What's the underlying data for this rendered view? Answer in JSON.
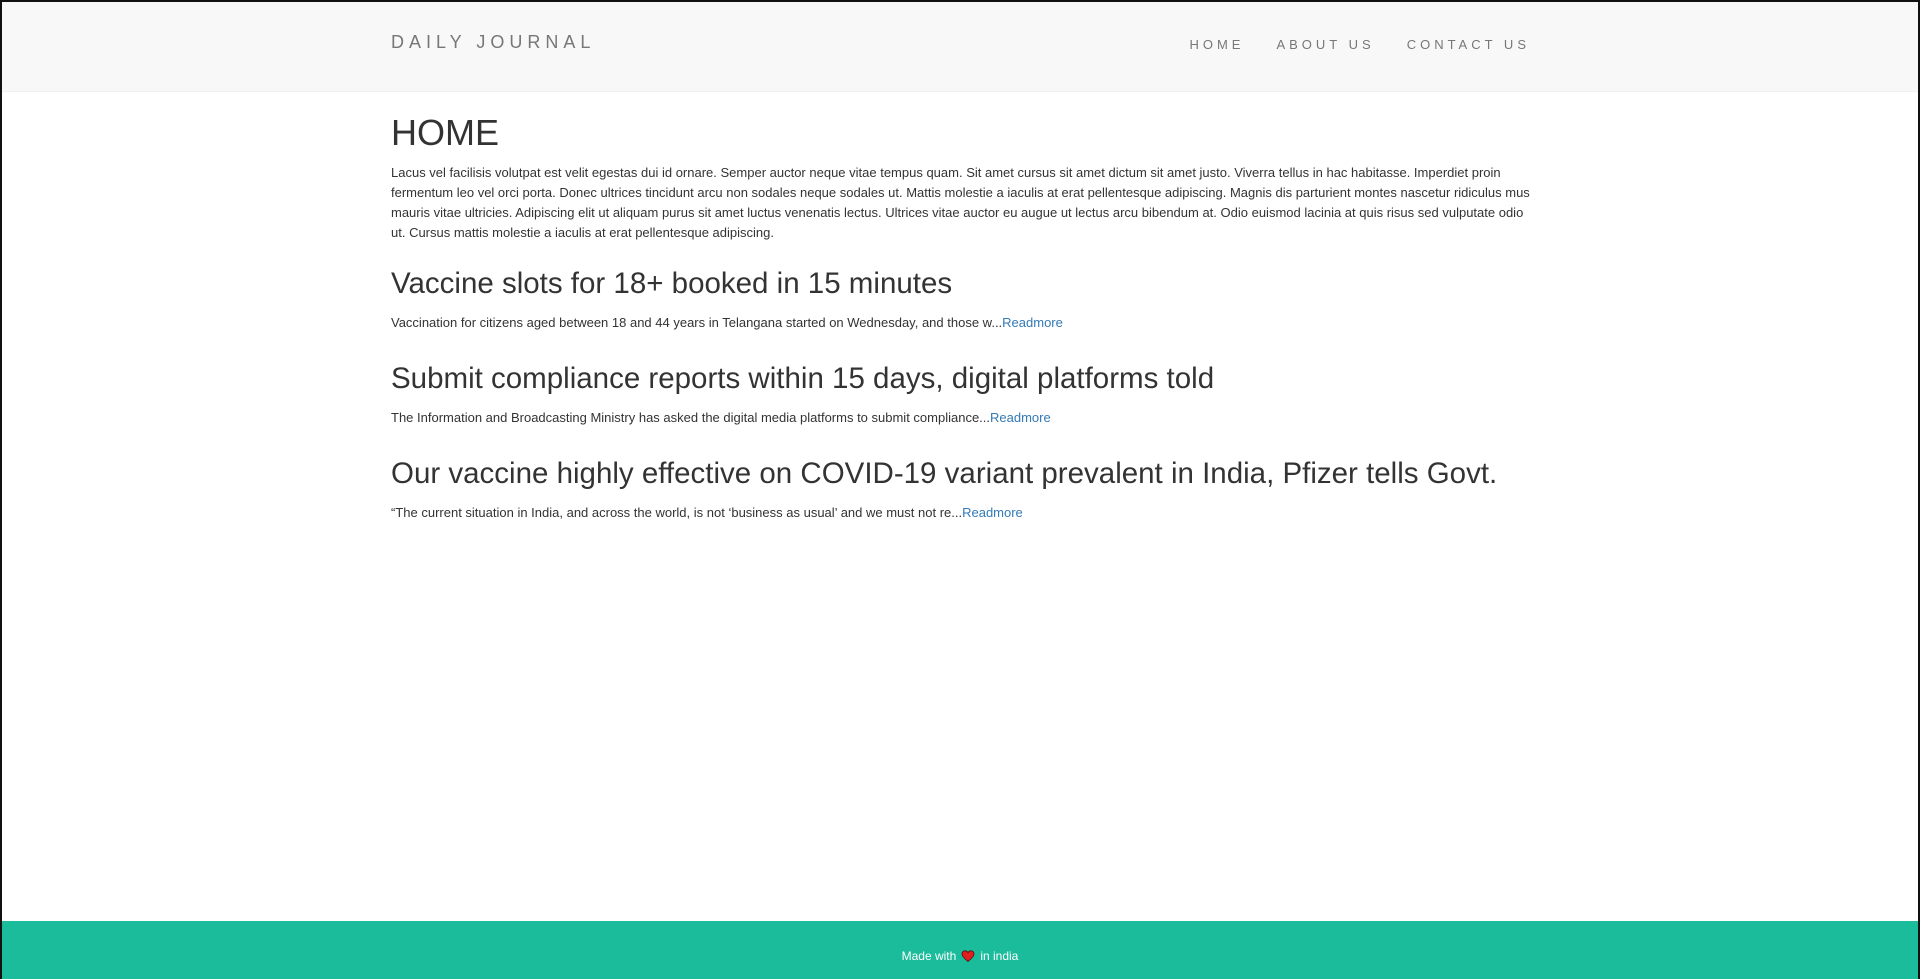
{
  "navbar": {
    "brand": "DAILY JOURNAL",
    "links": [
      {
        "label": "HOME"
      },
      {
        "label": "ABOUT US"
      },
      {
        "label": "CONTACT US"
      }
    ]
  },
  "main": {
    "title": "HOME",
    "intro": "Lacus vel facilisis volutpat est velit egestas dui id ornare. Semper auctor neque vitae tempus quam. Sit amet cursus sit amet dictum sit amet justo. Viverra tellus in hac habitasse. Imperdiet proin fermentum leo vel orci porta. Donec ultrices tincidunt arcu non sodales neque sodales ut. Mattis molestie a iaculis at erat pellentesque adipiscing. Magnis dis parturient montes nascetur ridiculus mus mauris vitae ultricies. Adipiscing elit ut aliquam purus sit amet luctus venenatis lectus. Ultrices vitae auctor eu augue ut lectus arcu bibendum at. Odio euismod lacinia at quis risus sed vulputate odio ut. Cursus mattis molestie a iaculis at erat pellentesque adipiscing.",
    "posts": [
      {
        "title": "Vaccine slots for 18+ booked in 15 minutes",
        "excerpt": "Vaccination for citizens aged between 18 and 44 years in Telangana started on Wednesday, and those w...",
        "readmore": "Readmore"
      },
      {
        "title": "Submit compliance reports within 15 days, digital platforms told",
        "excerpt": "The Information and Broadcasting Ministry has asked the digital media platforms to submit compliance...",
        "readmore": "Readmore"
      },
      {
        "title": "Our vaccine highly effective on COVID-19 variant prevalent in India, Pfizer tells Govt.",
        "excerpt": "“The current situation in India, and across the world, is not ‘business as usual’ and we must not re...",
        "readmore": "Readmore"
      }
    ]
  },
  "footer": {
    "text_before": "Made with",
    "icon": "heart-icon",
    "text_after": "in india"
  },
  "colors": {
    "navbar_bg": "#f8f8f8",
    "footer_bg": "#1abc9c",
    "link": "#337ab7",
    "heart": "#e0201e"
  }
}
